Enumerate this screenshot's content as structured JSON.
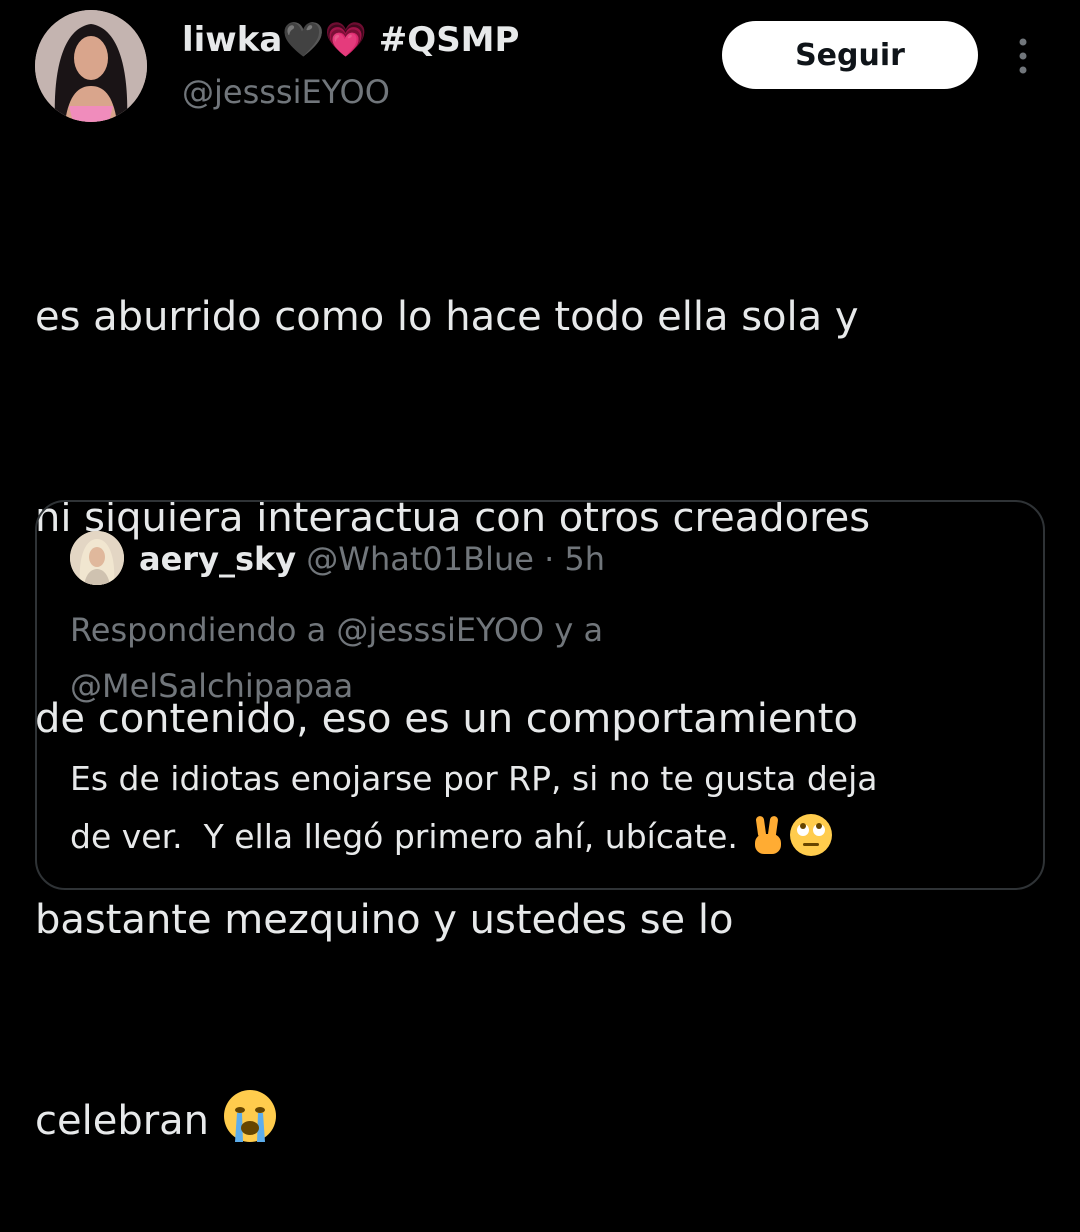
{
  "author": {
    "display_name": "liwka",
    "display_name_emoji": "🖤💗",
    "display_name_tag": "#QSMP",
    "handle": "@jesssiEYOO"
  },
  "follow_label": "Seguir",
  "tweet": {
    "lines": [
      "es aburrido como lo hace todo ella sola y",
      "ni siquiera interactua con otros creadores",
      "de contenido, eso es un comportamiento",
      "bastante mezquino y ustedes se lo",
      "celebran"
    ],
    "trailing_emoji": "😭"
  },
  "quoted": {
    "name": "aery_sky",
    "handle": "@What01Blue",
    "separator": "·",
    "time": "5h",
    "reply_lines": [
      "Respondiendo a @jesssiEYOO y a",
      "@MelSalchipapaa"
    ],
    "text_lines": [
      "Es de idiotas enojarse por RP, si no te gusta deja",
      "de ver.  Y ella llegó primero ahí, ubícate. "
    ],
    "trailing_emoji": "✌️🙄"
  },
  "colors": {
    "background": "#000000",
    "text": "#e7e9ea",
    "muted": "#71767b",
    "border": "#2f3336",
    "button_bg": "#ffffff",
    "button_text": "#0f1419"
  }
}
